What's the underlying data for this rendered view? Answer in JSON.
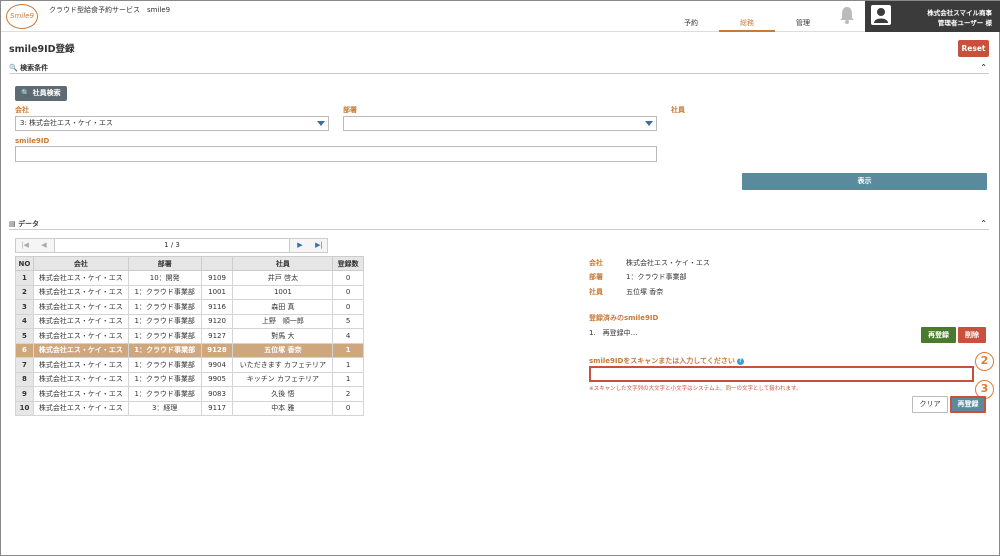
{
  "header": {
    "logo_text": "Smile9",
    "app_title": "クラウド型給食予約サービス　smile9",
    "nav": [
      "予約",
      "総務",
      "管理"
    ],
    "company": "株式会社スマイル商事",
    "user": "管理者ユーザー 様"
  },
  "page": {
    "title": "smile9ID登録",
    "reset_label": "Reset"
  },
  "search": {
    "section_title": "検索条件",
    "employee_search_button": "社員検索",
    "company_label": "会社",
    "company_value": "3: 株式会社エス・ケイ・エス",
    "dept_label": "部署",
    "dept_value": "",
    "employee_label": "社員",
    "smile9id_label": "smile9ID",
    "smile9id_value": "",
    "show_button": "表示"
  },
  "data_section": {
    "title": "データ",
    "pager": "1 / 3",
    "columns": [
      "NO",
      "会社",
      "部署",
      "",
      "社員",
      "登録数"
    ],
    "rows": [
      [
        "1",
        "株式会社エス・ケイ・エス",
        "10：開発",
        "9109",
        "井戸 啓太",
        "0"
      ],
      [
        "2",
        "株式会社エス・ケイ・エス",
        "1：クラウド事業部",
        "1001",
        "1001",
        "0"
      ],
      [
        "3",
        "株式会社エス・ケイ・エス",
        "1：クラウド事業部",
        "9116",
        "森田 真",
        "0"
      ],
      [
        "4",
        "株式会社エス・ケイ・エス",
        "1：クラウド事業部",
        "9120",
        "上野　順一郎",
        "5"
      ],
      [
        "5",
        "株式会社エス・ケイ・エス",
        "1：クラウド事業部",
        "9127",
        "對馬 大",
        "4"
      ],
      [
        "6",
        "株式会社エス・ケイ・エス",
        "1：クラウド事業部",
        "9128",
        "五位塚 香奈",
        "1"
      ],
      [
        "7",
        "株式会社エス・ケイ・エス",
        "1：クラウド事業部",
        "9904",
        "いただきます カフェテリア",
        "1"
      ],
      [
        "8",
        "株式会社エス・ケイ・エス",
        "1：クラウド事業部",
        "9905",
        "キッチン カフェテリア",
        "1"
      ],
      [
        "9",
        "株式会社エス・ケイ・エス",
        "1：クラウド事業部",
        "9083",
        "久後 悟",
        "2"
      ],
      [
        "10",
        "株式会社エス・ケイ・エス",
        "3：経理",
        "9117",
        "中本 雅",
        "0"
      ]
    ],
    "selected_row": 6
  },
  "detail": {
    "company_label": "会社",
    "company_value": "株式会社エス・ケイ・エス",
    "dept_label": "部署",
    "dept_value": "1：クラウド事業部",
    "employee_label": "社員",
    "employee_value": "五位塚 香奈",
    "registered_title": "登録済みのsmile9ID",
    "registered_item": "1.　再登録中…",
    "reregister_button": "再登録",
    "delete_button": "削除",
    "scan_label": "smile9IDをスキャンまたは入力してください",
    "help_icon": "?",
    "scan_value": "",
    "note": "※スキャンした文字列の大文字と小文字はシステム上、同一の文字として扱われます。",
    "clear_button": "クリア",
    "rereg_submit_button": "再登録",
    "callout_2": "2",
    "callout_3": "3"
  }
}
